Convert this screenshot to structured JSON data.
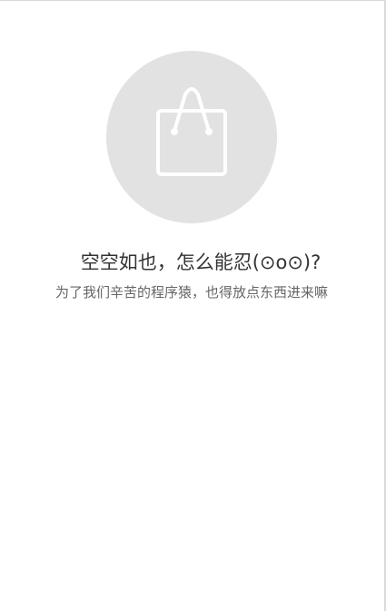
{
  "empty_state": {
    "icon": "shopping-bag-icon",
    "title": "空空如也，怎么能忍(⊙o⊙)?",
    "subtitle": "为了我们辛苦的程序猿，也得放点东西进来嘛"
  },
  "colors": {
    "background": "#ffffff",
    "circle": "#e2e2e2",
    "icon_stroke": "#ffffff",
    "title_text": "#333333",
    "subtitle_text": "#666666"
  }
}
